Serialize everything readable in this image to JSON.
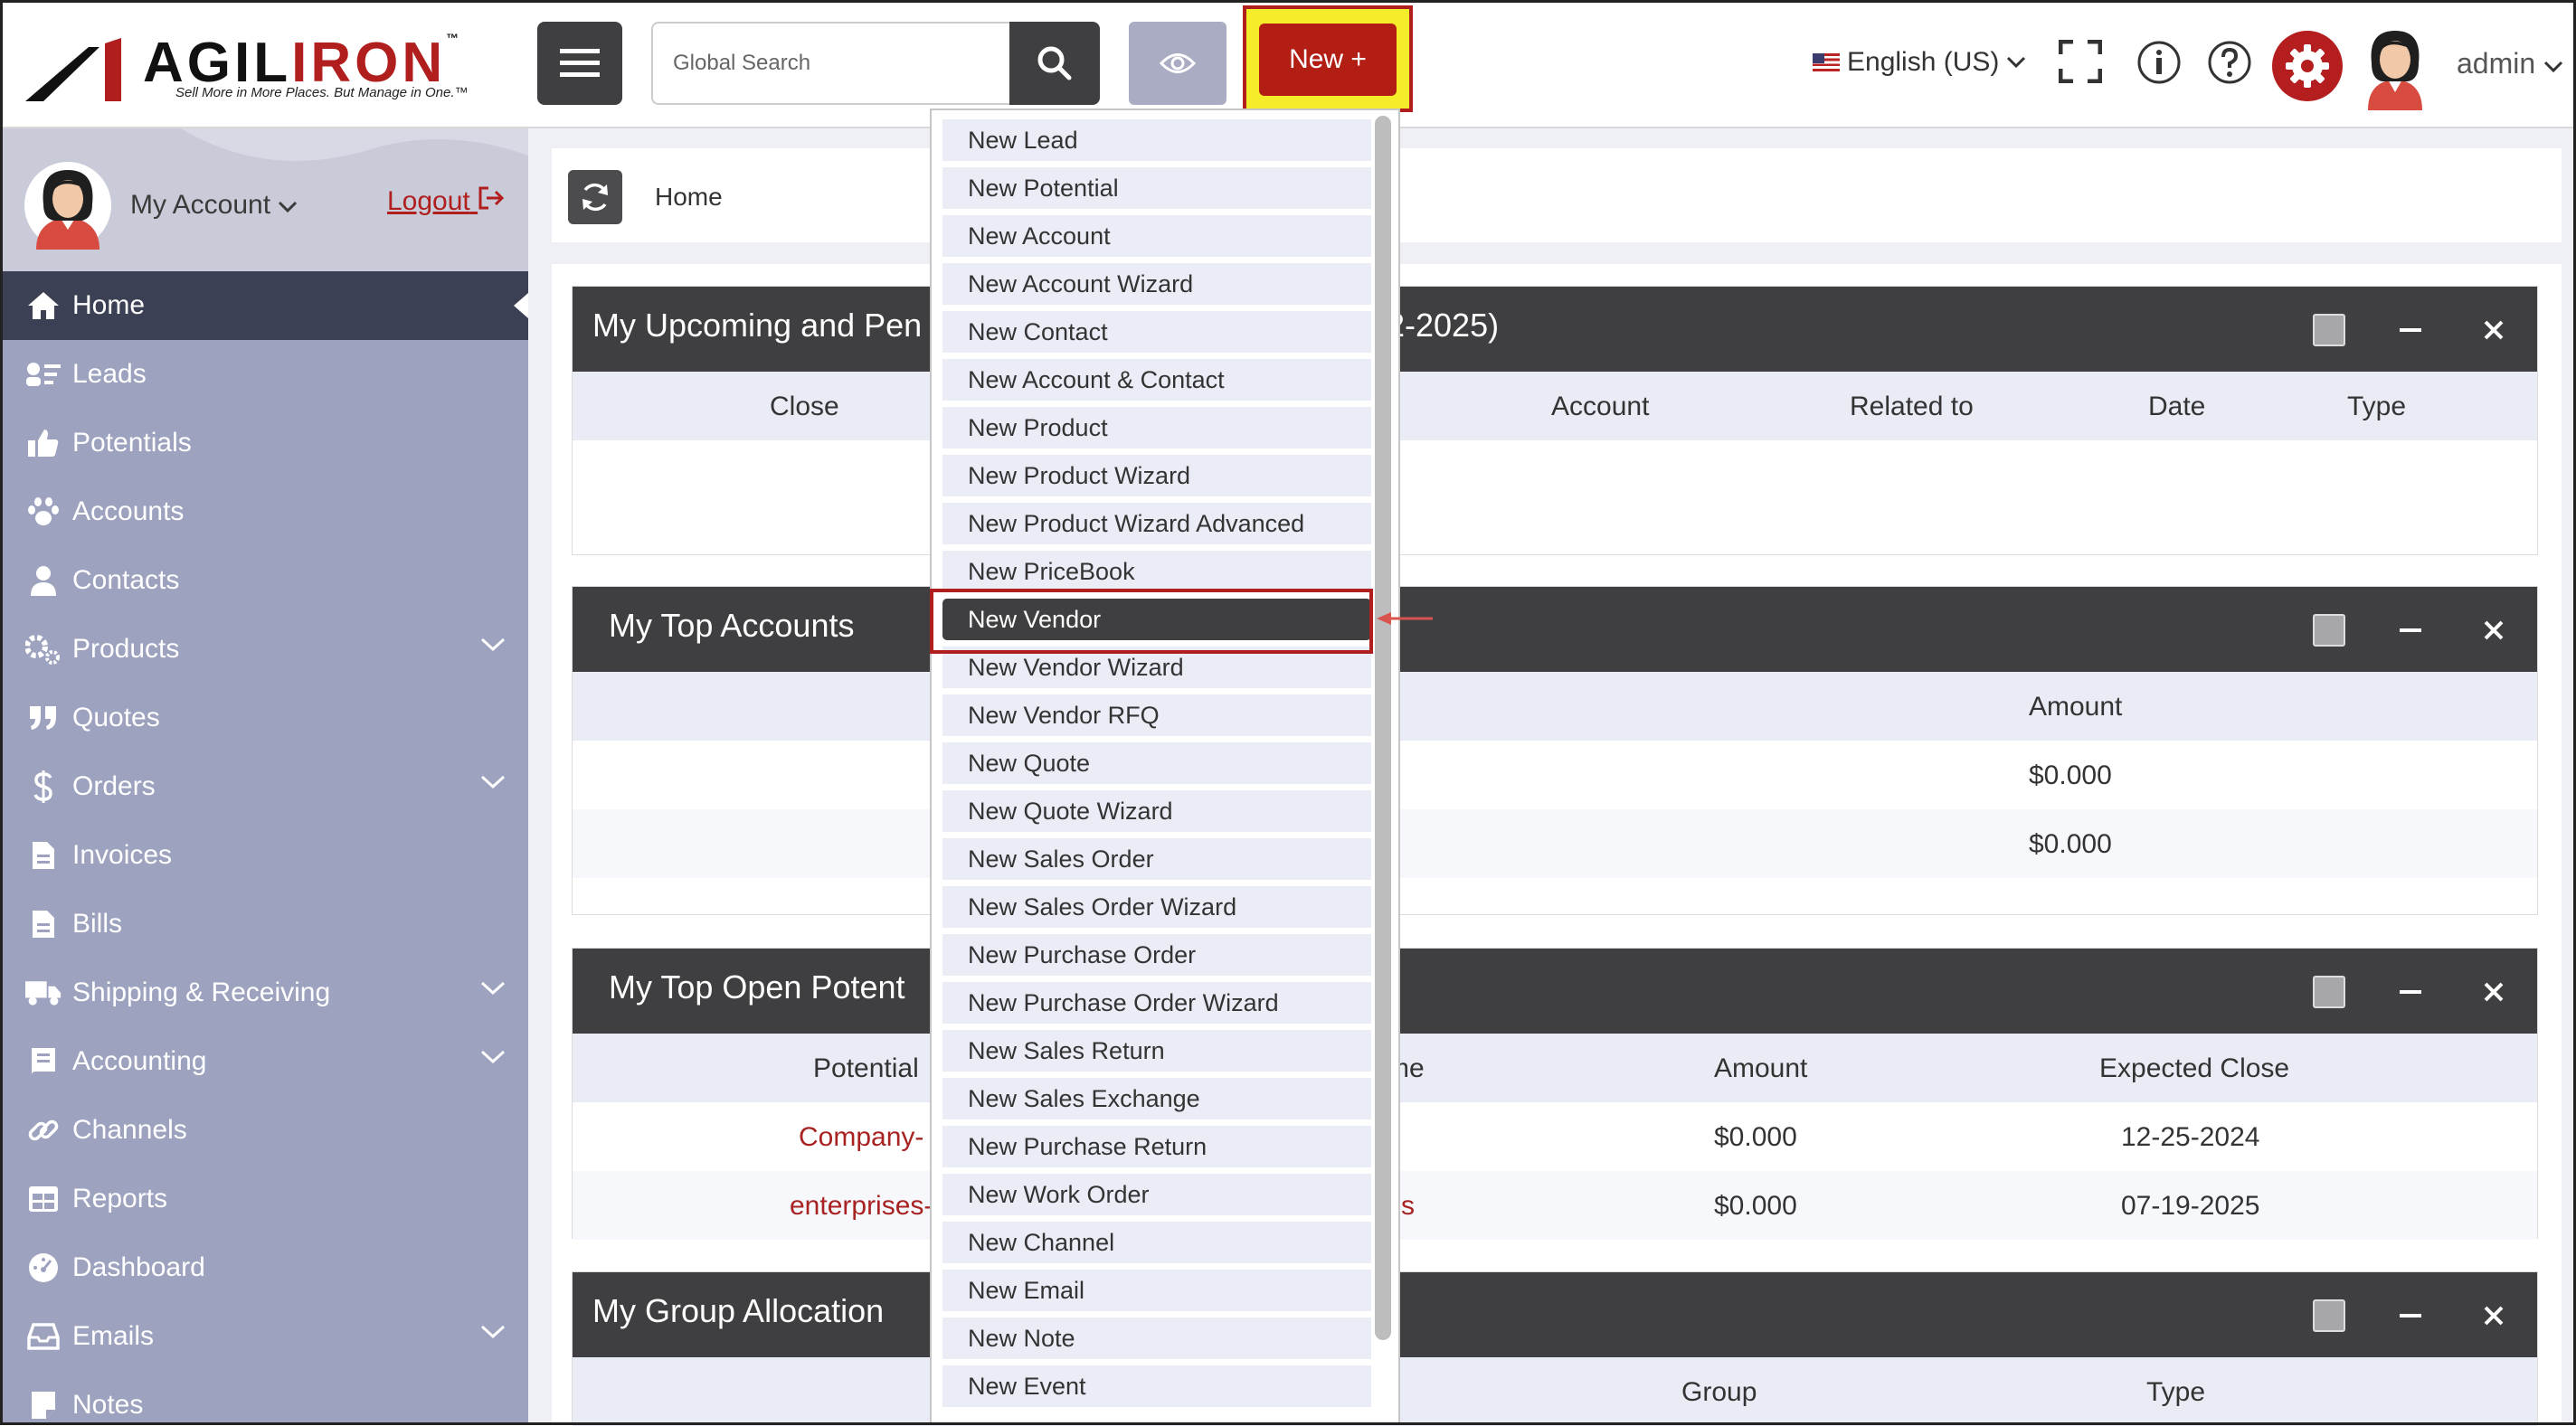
{
  "logo": {
    "word_prefix": "AGIL",
    "word_suffix": "IRON",
    "tm": "™",
    "tagline": "Sell More in More Places. But Manage in One.™"
  },
  "search": {
    "placeholder": "Global Search"
  },
  "new_button": {
    "label": "New +"
  },
  "language": {
    "label": "English (US)"
  },
  "user": {
    "name": "admin"
  },
  "sidebar": {
    "my_account": "My Account",
    "logout": "Logout",
    "items": [
      {
        "label": "Home",
        "icon": "home-icon"
      },
      {
        "label": "Leads",
        "icon": "leads-icon"
      },
      {
        "label": "Potentials",
        "icon": "thumbs-up-icon"
      },
      {
        "label": "Accounts",
        "icon": "paw-icon"
      },
      {
        "label": "Contacts",
        "icon": "user-icon"
      },
      {
        "label": "Products",
        "icon": "gears-icon"
      },
      {
        "label": "Quotes",
        "icon": "quote-icon"
      },
      {
        "label": "Orders",
        "icon": "dollar-icon"
      },
      {
        "label": "Invoices",
        "icon": "document-icon"
      },
      {
        "label": "Bills",
        "icon": "document-icon"
      },
      {
        "label": "Shipping & Receiving",
        "icon": "truck-icon"
      },
      {
        "label": "Accounting",
        "icon": "ledger-icon"
      },
      {
        "label": "Channels",
        "icon": "link-icon"
      },
      {
        "label": "Reports",
        "icon": "table-icon"
      },
      {
        "label": "Dashboard",
        "icon": "gauge-icon"
      },
      {
        "label": "Emails",
        "icon": "inbox-icon"
      },
      {
        "label": "Notes",
        "icon": "note-icon"
      }
    ]
  },
  "breadcrumb": {
    "home": "Home"
  },
  "widgets": {
    "upcoming": {
      "title_left": "My Upcoming and Pen",
      "title_right": "2-2025)",
      "columns": [
        "Close",
        "Account",
        "Related to",
        "Date",
        "Type"
      ]
    },
    "top_accounts": {
      "title": "My Top Accounts",
      "columns": [
        "Amount"
      ],
      "rows": [
        [
          "$0.000"
        ],
        [
          "$0.000"
        ]
      ]
    },
    "top_potentials": {
      "title": "My Top Open Potent",
      "columns": [
        "Potential",
        "me",
        "Amount",
        "Expected Close"
      ],
      "rows": [
        [
          "Company-",
          "",
          "$0.000",
          "12-25-2024"
        ],
        [
          "enterprises-",
          "s",
          "$0.000",
          "07-19-2025"
        ]
      ]
    },
    "group_allocation": {
      "title": "My Group Allocation",
      "columns": [
        "Group",
        "Type"
      ]
    }
  },
  "new_menu": {
    "selected": "New Vendor",
    "items": [
      "New Lead",
      "New Potential",
      "New Account",
      "New Account Wizard",
      "New Contact",
      "New Account & Contact",
      "New Product",
      "New Product Wizard",
      "New Product Wizard Advanced",
      "New PriceBook",
      "New Vendor",
      "New Vendor Wizard",
      "New Vendor RFQ",
      "New Quote",
      "New Quote Wizard",
      "New Sales Order",
      "New Sales Order Wizard",
      "New Purchase Order",
      "New Purchase Order Wizard",
      "New Sales Return",
      "New Sales Exchange",
      "New Purchase Return",
      "New Work Order",
      "New Channel",
      "New Email",
      "New Note",
      "New Event"
    ]
  },
  "colors": {
    "accent_red": "#b01e1e",
    "highlight_yellow": "#f5ec2a",
    "sidebar": "#9da2bf",
    "dark": "#3f3f41"
  }
}
